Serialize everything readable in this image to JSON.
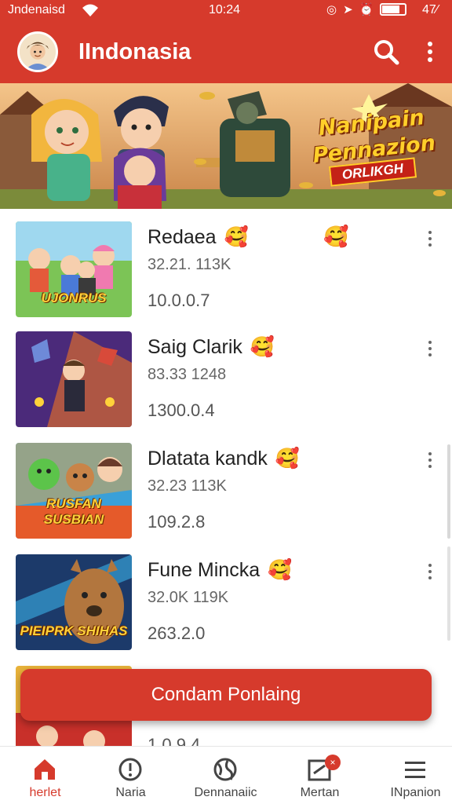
{
  "status_bar": {
    "carrier": "Jndenaisd",
    "time": "10:24",
    "battery": "47⁄"
  },
  "app_bar": {
    "title": "IIndonasia"
  },
  "banner": {
    "title_line1": "Nanipain",
    "title_line2": "Pennazion",
    "subtitle": "ORLIKGH"
  },
  "items": [
    {
      "name": "Redaea",
      "stats": "32.21. 113K",
      "version": "10.0.0.7",
      "caption": "UJONRUS"
    },
    {
      "name": "Saig Clarik",
      "stats": "83.33 1248",
      "version": "1300.0.4",
      "caption": ""
    },
    {
      "name": "Dlatata kandk",
      "stats": "32.23 113K",
      "version": "109.2.8",
      "caption": "RUSFAN SUSBIAN"
    },
    {
      "name": "Fune Mincka",
      "stats": "32.0K 119K",
      "version": "263.2.0",
      "caption": "PIEIPRK SHIHAS"
    },
    {
      "name": "",
      "stats": "",
      "version": "1.0.9 4",
      "caption": ""
    }
  ],
  "cta": {
    "label": "Condam Ponlaing"
  },
  "bottom_nav": [
    {
      "label": "herlet",
      "icon": "home-icon",
      "active": true
    },
    {
      "label": "Naria",
      "icon": "info-icon",
      "active": false
    },
    {
      "label": "Dennanaiic",
      "icon": "globe-icon",
      "active": false
    },
    {
      "label": "Mertan",
      "icon": "message-icon",
      "active": false,
      "badge": "×"
    },
    {
      "label": "INpanion",
      "icon": "menu-icon",
      "active": false
    }
  ],
  "colors": {
    "primary": "#d63a2c",
    "accent": "#ffcf2a"
  }
}
